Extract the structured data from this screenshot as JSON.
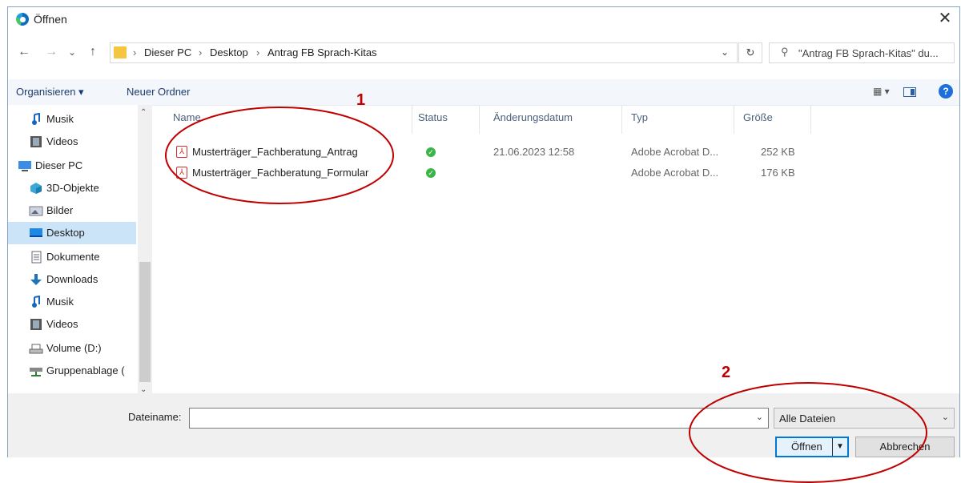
{
  "window": {
    "title": "Öffnen",
    "close_glyph": "✕"
  },
  "nav": {
    "back": "←",
    "forward": "→",
    "recent": "⌄",
    "up": "↑",
    "breadcrumb": [
      "Dieser PC",
      "Desktop",
      "Antrag FB Sprach-Kitas"
    ],
    "separator": "›",
    "search_placeholder": "\"Antrag FB Sprach-Kitas\" du...",
    "refresh_glyph": "↻"
  },
  "toolbar": {
    "organize": "Organisieren ▾",
    "new_folder": "Neuer Ordner",
    "help": "?"
  },
  "sidebar": {
    "items": [
      {
        "label": "Musik",
        "icon": "music-icon"
      },
      {
        "label": "Videos",
        "icon": "video-icon"
      },
      {
        "label": "Dieser PC",
        "icon": "pc-icon"
      },
      {
        "label": "3D-Objekte",
        "icon": "3d-objects-icon"
      },
      {
        "label": "Bilder",
        "icon": "pictures-icon"
      },
      {
        "label": "Desktop",
        "icon": "desktop-icon",
        "selected": true
      },
      {
        "label": "Dokumente",
        "icon": "documents-icon"
      },
      {
        "label": "Downloads",
        "icon": "downloads-icon"
      },
      {
        "label": "Musik",
        "icon": "music-icon"
      },
      {
        "label": "Videos",
        "icon": "video-icon"
      },
      {
        "label": "Volume (D:)",
        "icon": "drive-icon"
      },
      {
        "label": "Gruppenablage (",
        "icon": "network-drive-icon"
      }
    ]
  },
  "filelist": {
    "columns": [
      "Name",
      "Status",
      "Änderungsdatum",
      "Typ",
      "Größe"
    ],
    "rows": [
      {
        "name": "Musterträger_Fachberatung_Antrag",
        "status": "synced",
        "date": "21.06.2023 12:58",
        "type": "Adobe Acrobat D...",
        "size": "252 KB"
      },
      {
        "name": "Musterträger_Fachberatung_Formular",
        "status": "synced",
        "date": "",
        "type": "Adobe Acrobat D...",
        "size": "176 KB"
      }
    ]
  },
  "bottom": {
    "filename_label": "Dateiname:",
    "filename_value": "",
    "filetype": "Alle Dateien",
    "open": "Öffnen",
    "cancel": "Abbrechen"
  },
  "annotations": {
    "label1": "1",
    "label2": "2",
    "color": "#c00000"
  }
}
